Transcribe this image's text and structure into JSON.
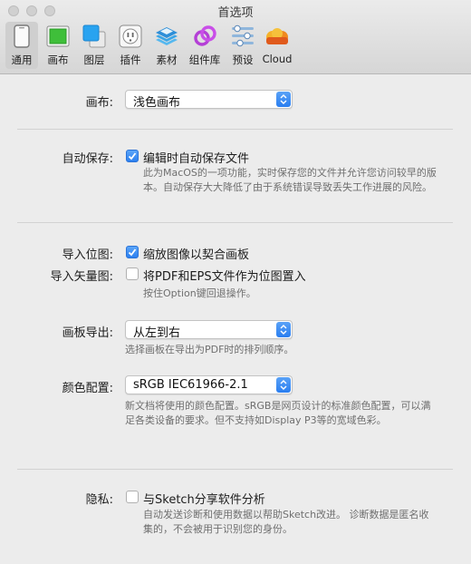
{
  "window": {
    "title": "首选项"
  },
  "toolbar": {
    "tabs": [
      {
        "label": "通用",
        "icon": "phone-general-icon"
      },
      {
        "label": "画布",
        "icon": "canvas-icon"
      },
      {
        "label": "图层",
        "icon": "layers-icon"
      },
      {
        "label": "插件",
        "icon": "plugin-icon"
      },
      {
        "label": "素材",
        "icon": "assets-icon"
      },
      {
        "label": "组件库",
        "icon": "library-icon"
      },
      {
        "label": "预设",
        "icon": "presets-icon"
      },
      {
        "label": "Cloud",
        "icon": "cloud-icon"
      }
    ],
    "active": "通用"
  },
  "settings": {
    "canvas": {
      "label": "画布:",
      "value": "浅色画布"
    },
    "autosave": {
      "label": "自动保存:",
      "checkbox_label": "编辑时自动保存文件",
      "checked": true,
      "hint_line1": "此为MacOS的一项功能，实时保存您的文件并允许您访问较早的版",
      "hint_line2": "本。自动保存大大降低了由于系统错误导致丢失工作进展的风险。"
    },
    "import_bitmap": {
      "label": "导入位图:",
      "checkbox_label": "缩放图像以契合画板",
      "checked": true
    },
    "import_vector": {
      "label": "导入矢量图:",
      "checkbox_label": "将PDF和EPS文件作为位图置入",
      "checked": false,
      "hint": "按住Option键回退操作。"
    },
    "artboard_export": {
      "label": "画板导出:",
      "value": "从左到右",
      "hint": "选择画板在导出为PDF时的排列顺序。"
    },
    "color_profile": {
      "label": "颜色配置:",
      "value": "sRGB IEC61966-2.1",
      "hint_line1": "新文档将使用的颜色配置。sRGB是网页设计的标准颜色配置，可以满",
      "hint_line2": "足各类设备的要求。但不支持如Display P3等的宽域色彩。"
    },
    "privacy": {
      "label": "隐私:",
      "checkbox_label": "与Sketch分享软件分析",
      "checked": false,
      "hint_line1": "自动发送诊断和使用数据以帮助Sketch改进。 诊断数据是匿名收",
      "hint_line2": "集的，不会被用于识别您的身份。"
    }
  },
  "colors": {
    "accent": "#2c80f0",
    "background": "#ececec"
  }
}
